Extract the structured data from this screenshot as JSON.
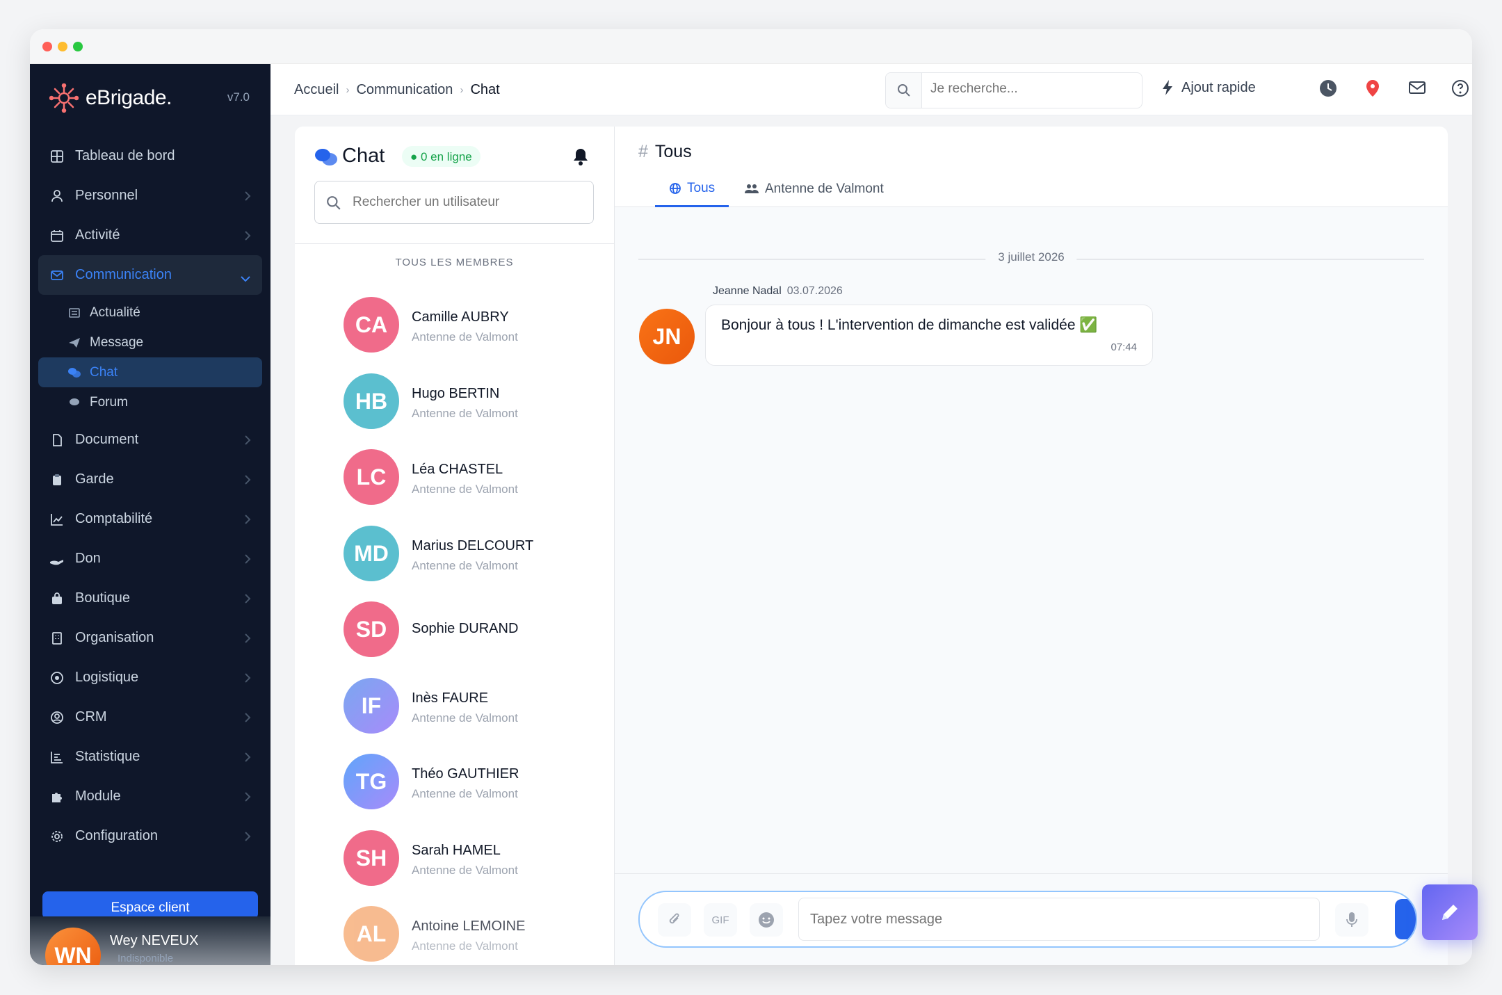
{
  "app": {
    "name": "eBrigade.",
    "version": "v7.0"
  },
  "sidebar": {
    "items": [
      {
        "label": "Tableau de bord",
        "icon": "dashboard-icon"
      },
      {
        "label": "Personnel",
        "icon": "user-icon"
      },
      {
        "label": "Activité",
        "icon": "calendar-icon"
      },
      {
        "label": "Communication",
        "icon": "mail-icon",
        "active": true
      },
      {
        "label": "Document",
        "icon": "file-icon"
      },
      {
        "label": "Garde",
        "icon": "clipboard-icon"
      },
      {
        "label": "Comptabilité",
        "icon": "chart-line-icon"
      },
      {
        "label": "Don",
        "icon": "hand-icon"
      },
      {
        "label": "Boutique",
        "icon": "bag-icon"
      },
      {
        "label": "Organisation",
        "icon": "building-icon"
      },
      {
        "label": "Logistique",
        "icon": "target-icon"
      },
      {
        "label": "CRM",
        "icon": "user-circle-icon"
      },
      {
        "label": "Statistique",
        "icon": "stats-icon"
      },
      {
        "label": "Module",
        "icon": "puzzle-icon"
      },
      {
        "label": "Configuration",
        "icon": "gear-icon"
      }
    ],
    "subitems": [
      {
        "label": "Actualité",
        "icon": "newspaper-icon"
      },
      {
        "label": "Message",
        "icon": "send-icon"
      },
      {
        "label": "Chat",
        "icon": "chat-icon",
        "active": true
      },
      {
        "label": "Forum",
        "icon": "comment-icon"
      }
    ],
    "client_button": "Espace client",
    "user": {
      "initials": "WN",
      "name": "Wey NEVEUX",
      "status": "Indisponible"
    }
  },
  "topbar": {
    "breadcrumb": [
      "Accueil",
      "Communication",
      "Chat"
    ],
    "search_placeholder": "Je recherche...",
    "quick_add": "Ajout rapide"
  },
  "chat": {
    "title": "Chat",
    "online": "0 en ligne",
    "user_search_placeholder": "Rechercher un utilisateur",
    "members_header": "TOUS LES MEMBRES",
    "members": [
      {
        "initials": "CA",
        "name": "Camille AUBRY",
        "group": "Antenne de Valmont",
        "color": "#f06b8a"
      },
      {
        "initials": "HB",
        "name": "Hugo BERTIN",
        "group": "Antenne de Valmont",
        "color": "#5bbfcf"
      },
      {
        "initials": "LC",
        "name": "Léa CHASTEL",
        "group": "Antenne de Valmont",
        "color": "#f06b8a"
      },
      {
        "initials": "MD",
        "name": "Marius DELCOURT",
        "group": "Antenne de Valmont",
        "color": "#5bbfcf"
      },
      {
        "initials": "SD",
        "name": "Sophie DURAND",
        "group": "",
        "color": "#f06b8a"
      },
      {
        "initials": "IF",
        "name": "Inès FAURE",
        "group": "Antenne de Valmont",
        "color": "#8b9bf5"
      },
      {
        "initials": "TG",
        "name": "Théo GAUTHIER",
        "group": "Antenne de Valmont",
        "color": "#6aa6e8"
      },
      {
        "initials": "SH",
        "name": "Sarah HAMEL",
        "group": "Antenne de Valmont",
        "color": "#f06b8a"
      },
      {
        "initials": "AL",
        "name": "Antoine LEMOINE",
        "group": "Antenne de Valmont",
        "color": "#f5a56b"
      }
    ]
  },
  "channel": {
    "title": "Tous",
    "tabs": [
      {
        "label": "Tous",
        "icon": "globe-icon",
        "active": true
      },
      {
        "label": "Antenne de Valmont",
        "icon": "users-icon"
      }
    ],
    "date": "3 juillet 2026",
    "message": {
      "author": "Jeanne Nadal",
      "date": "03.07.2026",
      "initials": "JN",
      "text": "Bonjour à tous ! L'intervention de dimanche est validée ✅",
      "time": "07:44"
    },
    "composer": {
      "gif": "GIF",
      "placeholder": "Tapez votre message"
    }
  },
  "colors": {
    "accent": "#2563eb",
    "sidebar_bg": "#0f172a",
    "online": "#16a34a"
  }
}
